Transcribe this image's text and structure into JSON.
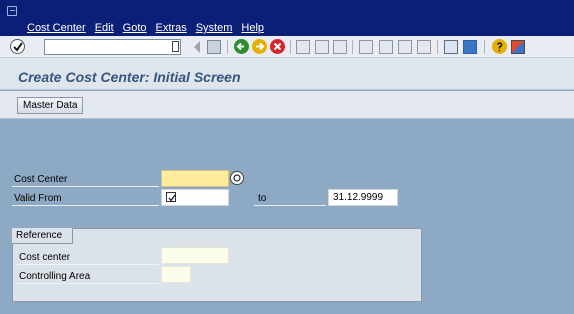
{
  "menu": {
    "items": [
      "Cost Center",
      "Edit",
      "Goto",
      "Extras",
      "System",
      "Help"
    ]
  },
  "toolbar": {
    "command_field_value": ""
  },
  "header": {
    "title": "Create Cost Center: Initial Screen"
  },
  "apptoolbar": {
    "master_data_label": "Master Data"
  },
  "form": {
    "cost_center_label": "Cost Center",
    "cost_center_value": "",
    "valid_from_label": "Valid From",
    "valid_from_value": "",
    "to_label": "to",
    "valid_to_value": "31.12.9999"
  },
  "reference": {
    "group_title": "Reference",
    "cost_center_label": "Cost center",
    "cost_center_value": "",
    "controlling_area_label": "Controlling Area",
    "controlling_area_value": ""
  },
  "colors": {
    "menubar": "#0c1f76",
    "body": "#8ea9c3",
    "required_field": "#ffeb9c",
    "title_text": "#36557f"
  }
}
